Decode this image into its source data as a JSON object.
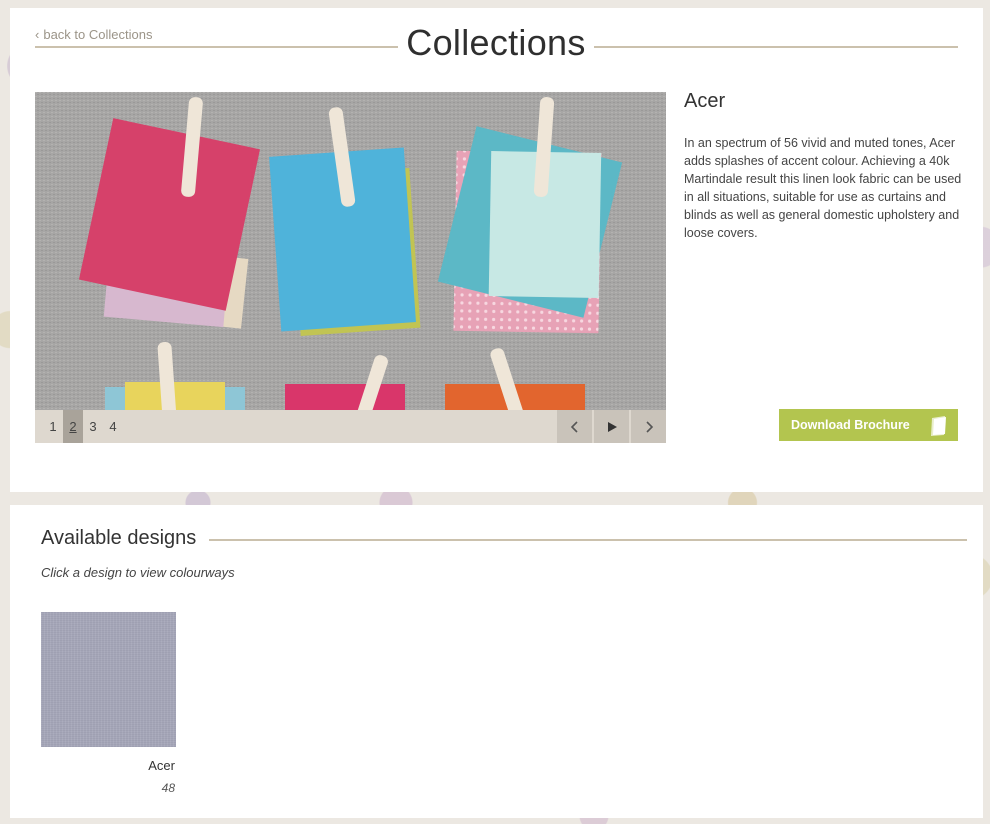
{
  "header": {
    "back_link": "back to Collections",
    "title": "Collections"
  },
  "slideshow": {
    "pages": [
      "1",
      "2",
      "3",
      "4"
    ],
    "active_page": "2",
    "controls": [
      "chevron-left-icon",
      "play-icon",
      "chevron-right-icon"
    ]
  },
  "collection": {
    "name": "Acer",
    "description": "In an spectrum of 56 vivid and muted tones, Acer adds splashes of accent colour. Achieving a 40k Martindale result this linen look fabric can be used in all situations, suitable for use as curtains and blinds as well as general domestic upholstery and loose covers.",
    "download_label": "Download Brochure"
  },
  "designs_section": {
    "title": "Available designs",
    "hint": "Click a design to view colourways",
    "items": [
      {
        "name": "Acer",
        "count": "48"
      }
    ]
  },
  "colors": {
    "accent_green": "#b3c54f",
    "rule": "#cbc1ad",
    "slider_bar": "#ded8cf"
  }
}
